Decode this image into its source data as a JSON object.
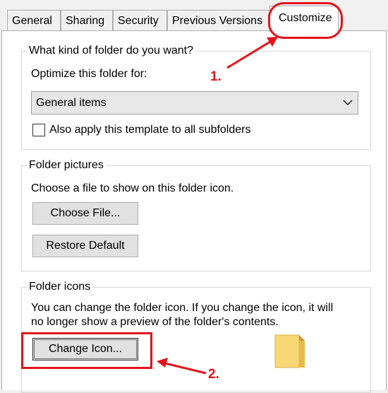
{
  "tabs": [
    {
      "label": "General",
      "active": false
    },
    {
      "label": "Sharing",
      "active": false
    },
    {
      "label": "Security",
      "active": false
    },
    {
      "label": "Previous Versions",
      "active": false
    },
    {
      "label": "Customize",
      "active": true
    }
  ],
  "optimize_group": {
    "legend": "What kind of folder do you want?",
    "optimize_label": "Optimize this folder for:",
    "select_value": "General items",
    "checkbox_label": "Also apply this template to all subfolders",
    "checkbox_checked": false
  },
  "pictures_group": {
    "legend": "Folder pictures",
    "description": "Choose a file to show on this folder icon.",
    "choose_file_label": "Choose File...",
    "restore_default_label": "Restore Default"
  },
  "icons_group": {
    "legend": "Folder icons",
    "description_line1": "You can change the folder icon. If you change the icon, it will",
    "description_line2": "no longer show a preview of the folder's contents.",
    "change_icon_label": "Change Icon...",
    "folder_icon": "folder-icon"
  },
  "annotations": {
    "step1": "1.",
    "step2": "2.",
    "color": "#e4141b"
  }
}
